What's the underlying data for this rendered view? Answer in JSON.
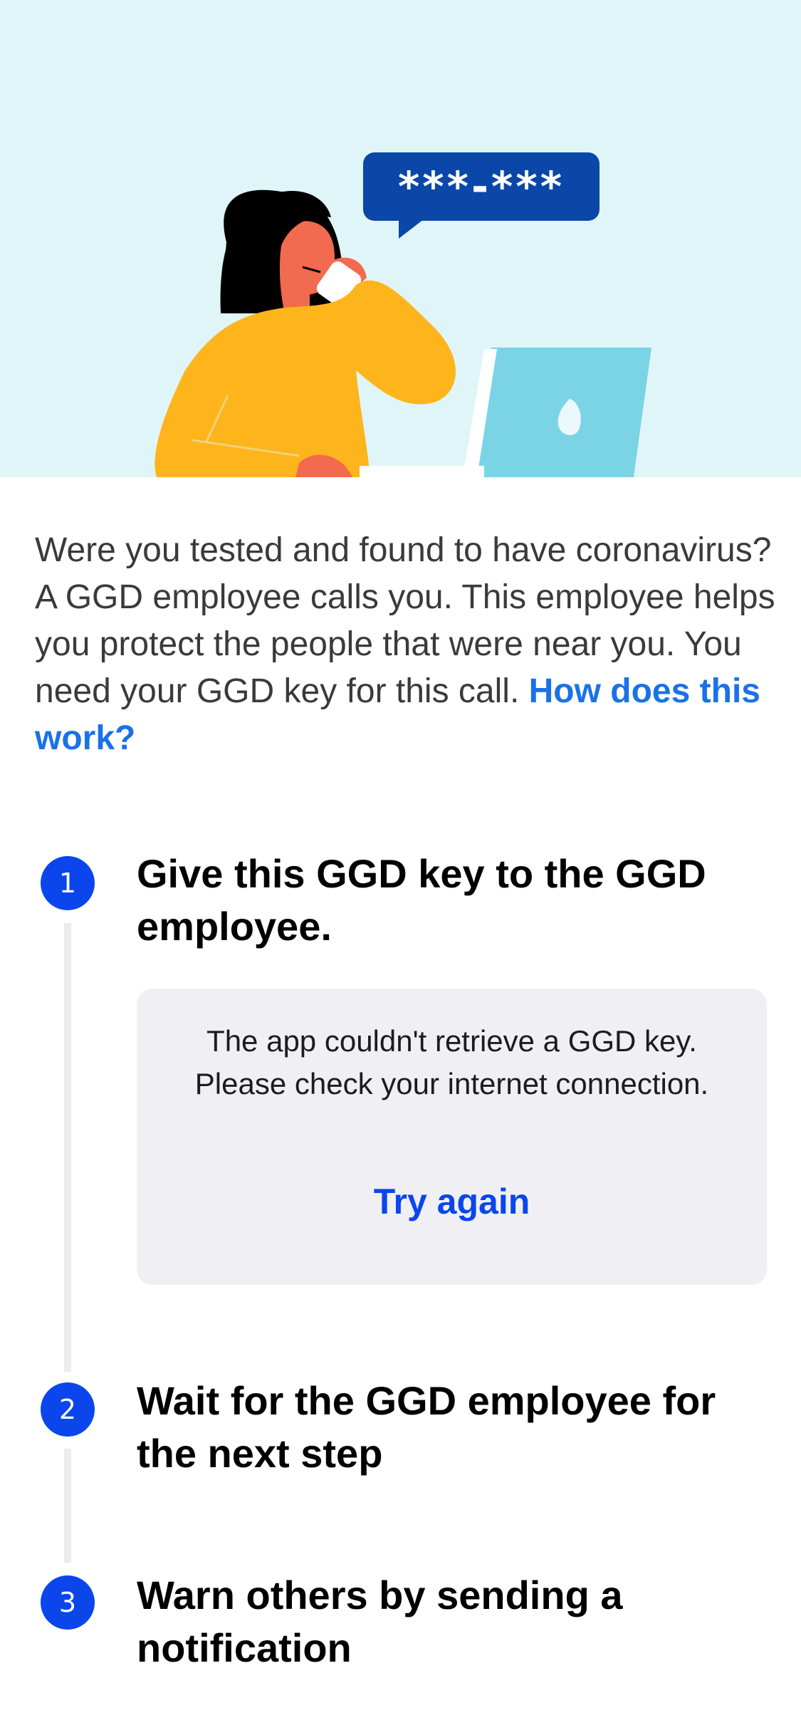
{
  "illustration": {
    "bubble_text": "***-***"
  },
  "intro": {
    "text": "Were you tested and found to have coronavirus? A GGD employee calls you. This employee helps you protect the people that were near you. You need your GGD key for this call.",
    "link_label": "How does this work?"
  },
  "steps": [
    {
      "number": "1",
      "title": "Give this GGD key to the GGD employee."
    },
    {
      "number": "2",
      "title": "Wait for the GGD employee for the next step"
    },
    {
      "number": "3",
      "title": "Warn others by sending a notification"
    }
  ],
  "error_card": {
    "message": "The app couldn't retrieve a GGD key. Please check your internet connection.",
    "retry_label": "Try again"
  },
  "colors": {
    "hero_background": "#e0f5f8",
    "step_circle": "#0a46ec",
    "link": "#1a72e8",
    "bubble": "#0a47a8",
    "laptop": "#7ad4e6",
    "sweater": "#fdb51b",
    "skin": "#f26a4f"
  }
}
